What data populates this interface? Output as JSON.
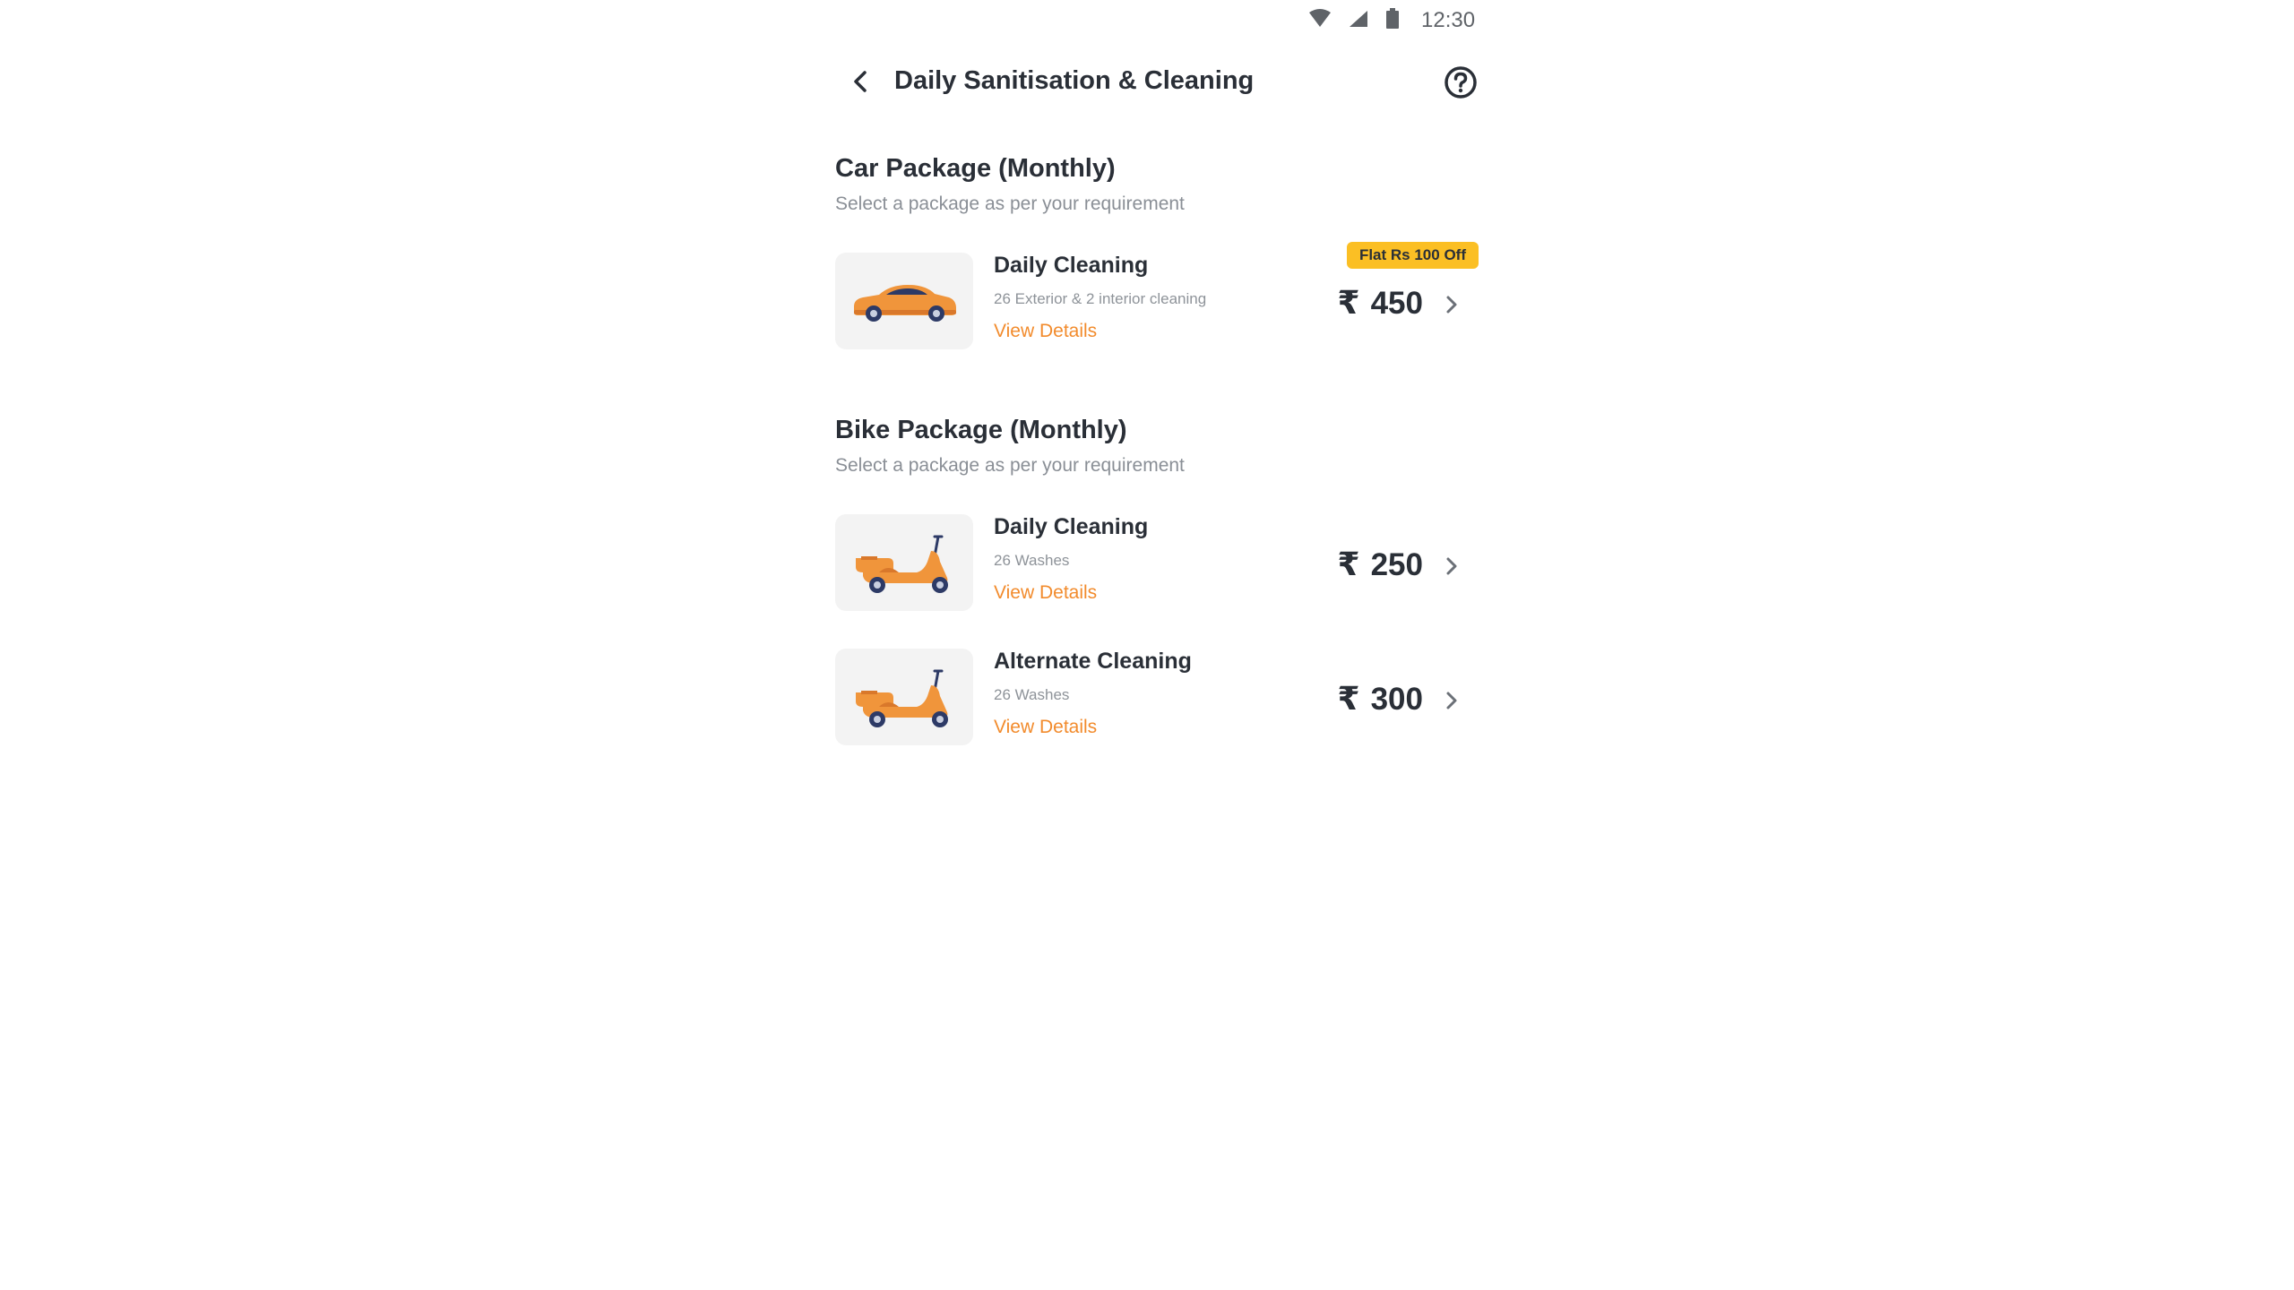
{
  "status_bar": {
    "time": "12:30",
    "icons": [
      "wifi-icon",
      "cellular-signal-icon",
      "battery-icon"
    ]
  },
  "header": {
    "title": "Daily Sanitisation & Cleaning",
    "back_icon": "back-arrow-icon",
    "help_icon": "help-icon"
  },
  "car_section": {
    "title": "Car Package (Monthly)",
    "subtitle": "Select a package as per your requirement",
    "packages": [
      {
        "name": "Daily Cleaning",
        "description": "26 Exterior & 2 interior cleaning",
        "details_label": "View Details",
        "currency": "₹",
        "price": "450",
        "badge": "Flat Rs 100 Off",
        "image": "car-icon"
      }
    ]
  },
  "bike_section": {
    "title": "Bike Package (Monthly)",
    "subtitle": "Select a package as per your requirement",
    "packages": [
      {
        "name": "Daily Cleaning",
        "description": "26 Washes",
        "details_label": "View Details",
        "currency": "₹",
        "price": "250",
        "image": "scooter-icon"
      },
      {
        "name": "Alternate Cleaning",
        "description": "26 Washes",
        "details_label": "View Details",
        "currency": "₹",
        "price": "300",
        "image": "scooter-icon"
      }
    ]
  },
  "colors": {
    "accent": "#f28b2c",
    "badge": "#fbbf24",
    "text_primary": "#2a2f37",
    "text_secondary": "#8a8f96",
    "thumb_bg": "#f3f3f3"
  }
}
